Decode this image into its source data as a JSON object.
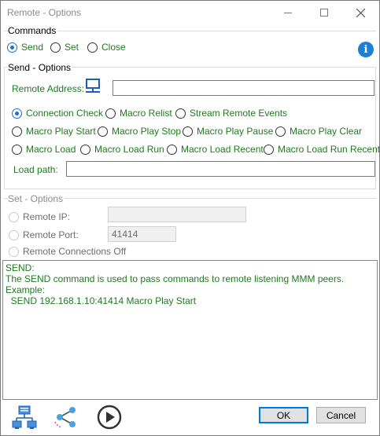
{
  "window": {
    "title": "Remote - Options"
  },
  "commands": {
    "label": "Commands",
    "options": [
      {
        "label": "Send",
        "checked": true
      },
      {
        "label": "Set",
        "checked": false
      },
      {
        "label": "Close",
        "checked": false
      }
    ]
  },
  "send_options": {
    "label": "Send - Options",
    "remote_address_label": "Remote Address:",
    "remote_address_value": "",
    "load_path_label": "Load path:",
    "load_path_value": "",
    "radios": [
      {
        "label": "Connection Check",
        "checked": true
      },
      {
        "label": "Macro Relist",
        "checked": false
      },
      {
        "label": "Stream Remote Events",
        "checked": false
      },
      {
        "label": "Macro Play Start",
        "checked": false
      },
      {
        "label": "Macro Play Stop",
        "checked": false
      },
      {
        "label": "Macro Play Pause",
        "checked": false
      },
      {
        "label": "Macro Play Clear",
        "checked": false
      },
      {
        "label": "Macro Load",
        "checked": false
      },
      {
        "label": "Macro Load Run",
        "checked": false
      },
      {
        "label": "Macro Load Recent",
        "checked": false
      },
      {
        "label": "Macro Load Run Recent",
        "checked": false
      }
    ]
  },
  "set_options": {
    "label": "Set - Options",
    "remote_ip_label": "Remote IP:",
    "remote_ip_value": "",
    "remote_port_label": "Remote Port:",
    "remote_port_value": "41414",
    "remote_connections_off_label": "Remote Connections Off"
  },
  "output": {
    "lines": [
      "SEND:",
      "The SEND command is used to pass commands to remote listening MMM peers.",
      "",
      "Example:",
      "  SEND 192.168.1.10:41414 Macro Play Start"
    ]
  },
  "buttons": {
    "ok": "OK",
    "cancel": "Cancel"
  },
  "colors": {
    "accent": "#1a6fd1",
    "label_green": "#1f7a1f",
    "info_blue": "#1c7fd6"
  },
  "icons": [
    "network-computers-icon",
    "share-icon",
    "play-icon",
    "info-icon",
    "monitor-network-icon"
  ]
}
